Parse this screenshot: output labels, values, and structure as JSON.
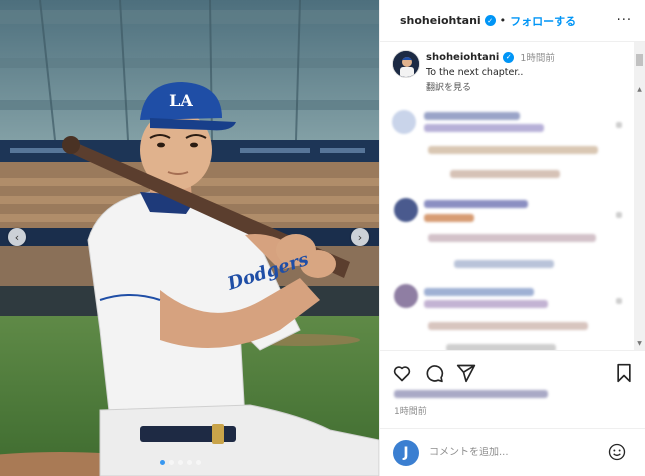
{
  "header": {
    "username": "shoheiohtani",
    "separator": "•",
    "follow_label": "フォローする",
    "more_icon": "more-horizontal-icon",
    "more_glyph": "···"
  },
  "caption": {
    "username": "shoheiohtani",
    "time": "1時間前",
    "text": "To the next chapter..",
    "translate_label": "翻訳を見る"
  },
  "photo": {
    "cap_logo": "LA",
    "jersey_text": "Dodgers",
    "carousel_prev": "‹",
    "carousel_next": "›"
  },
  "actions": {
    "like_icon": "heart-icon",
    "comment_icon": "comment-icon",
    "share_icon": "share-icon",
    "save_icon": "bookmark-icon"
  },
  "post_time": "1時間前",
  "comment_box": {
    "avatar_letter": "J",
    "placeholder": "コメントを追加...",
    "emoji_icon": "emoji-icon"
  },
  "colors": {
    "accent": "#0095f6",
    "cap_blue": "#1f4ea6",
    "panel_border": "#efefef"
  }
}
